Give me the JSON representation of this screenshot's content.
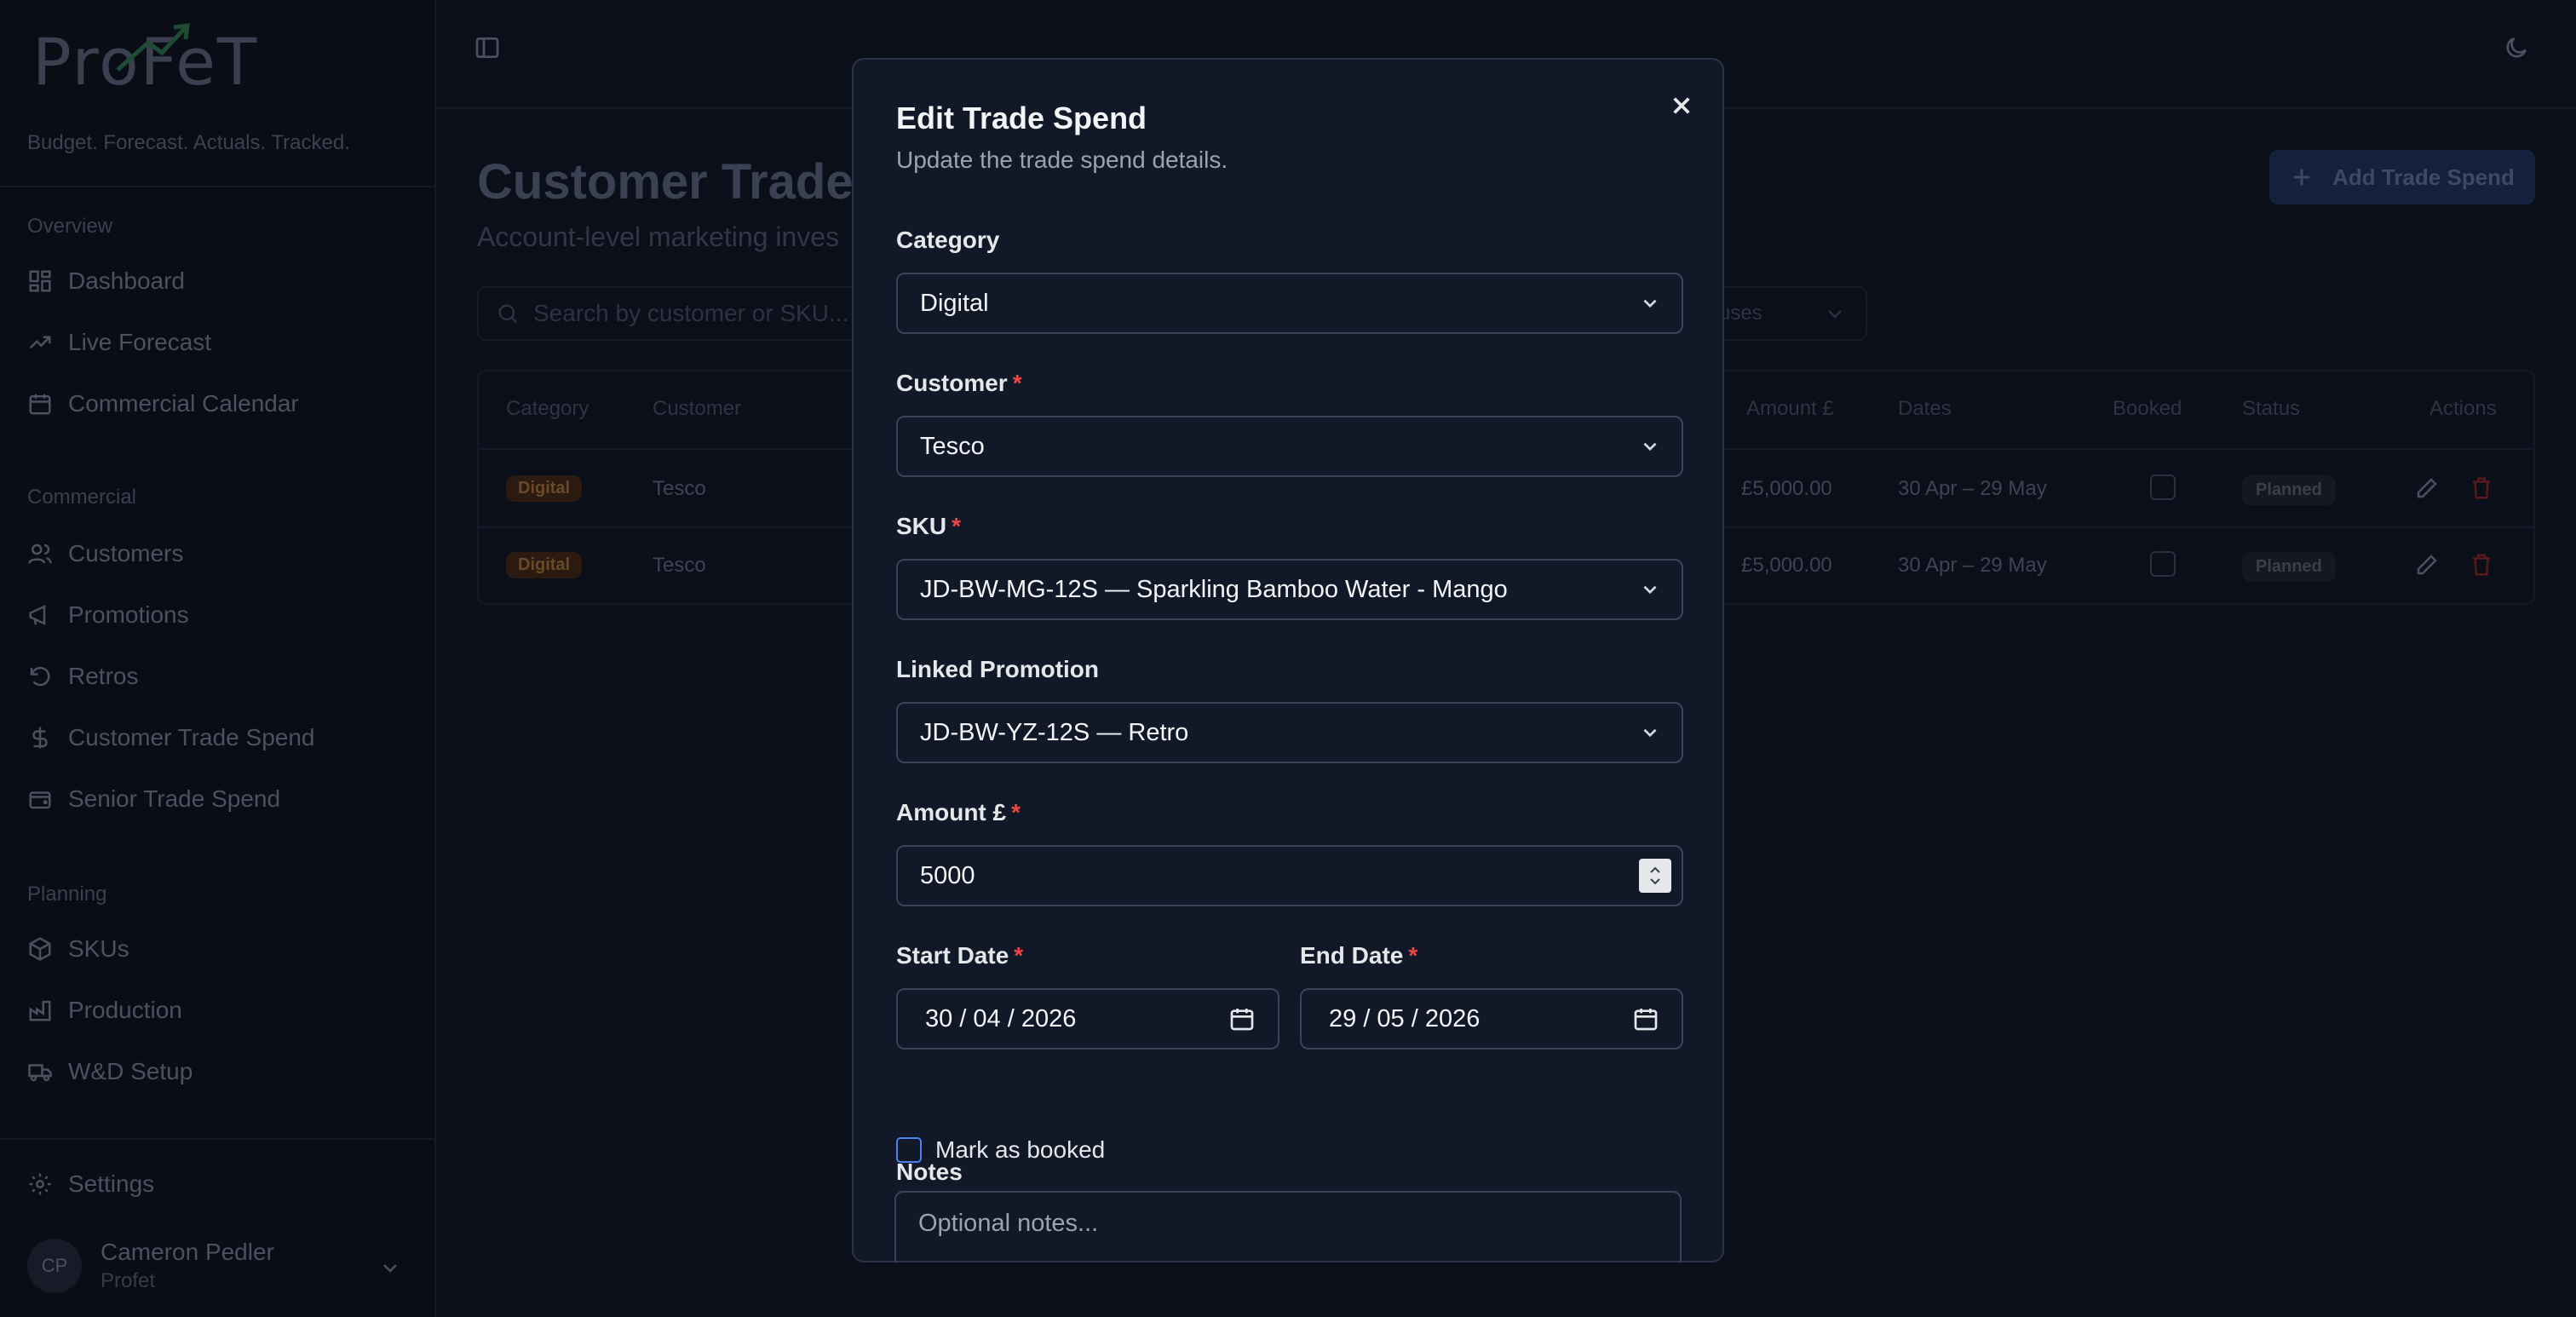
{
  "app": {
    "logo_text": "ProFeT",
    "tagline": "Budget. Forecast. Actuals. Tracked."
  },
  "sidebar": {
    "sections": [
      {
        "title": "Overview",
        "items": [
          {
            "label": "Dashboard",
            "icon": "grid-icon"
          },
          {
            "label": "Live Forecast",
            "icon": "trending-up-icon"
          },
          {
            "label": "Commercial Calendar",
            "icon": "calendar-icon"
          }
        ]
      },
      {
        "title": "Commercial",
        "items": [
          {
            "label": "Customers",
            "icon": "users-icon"
          },
          {
            "label": "Promotions",
            "icon": "megaphone-icon"
          },
          {
            "label": "Retros",
            "icon": "rotate-ccw-icon"
          },
          {
            "label": "Customer Trade Spend",
            "icon": "dollar-icon"
          },
          {
            "label": "Senior Trade Spend",
            "icon": "wallet-icon"
          }
        ]
      },
      {
        "title": "Planning",
        "items": [
          {
            "label": "SKUs",
            "icon": "box-icon"
          },
          {
            "label": "Production",
            "icon": "factory-icon"
          },
          {
            "label": "W&D Setup",
            "icon": "truck-icon"
          }
        ]
      }
    ],
    "settings_label": "Settings",
    "user": {
      "initials": "CP",
      "name": "Cameron Pedler",
      "org": "Profet"
    }
  },
  "page": {
    "title": "Customer Trade",
    "subtitle": "Account-level marketing inves",
    "add_button": "Add Trade Spend",
    "search_placeholder": "Search by customer or SKU...",
    "status_filter": "uses"
  },
  "table": {
    "headers": [
      "Category",
      "Customer",
      "Amount £",
      "Dates",
      "Booked",
      "Status",
      "Actions"
    ],
    "rows": [
      {
        "category": "Digital",
        "customer": "Tesco",
        "amount": "£5,000.00",
        "dates": "30 Apr – 29 May",
        "status": "Planned"
      },
      {
        "category": "Digital",
        "customer": "Tesco",
        "amount": "£5,000.00",
        "dates": "30 Apr – 29 May",
        "status": "Planned"
      }
    ]
  },
  "modal": {
    "title": "Edit Trade Spend",
    "subtitle": "Update the trade spend details.",
    "category": {
      "label": "Category",
      "value": "Digital"
    },
    "customer": {
      "label": "Customer",
      "value": "Tesco"
    },
    "sku": {
      "label": "SKU",
      "value": "JD-BW-MG-12S — Sparkling Bamboo Water - Mango"
    },
    "promotion": {
      "label": "Linked Promotion",
      "value": "JD-BW-YZ-12S — Retro"
    },
    "amount": {
      "label": "Amount £",
      "value": "5000"
    },
    "start_date": {
      "label": "Start Date",
      "value": "30 / 04 / 2026"
    },
    "end_date": {
      "label": "End Date",
      "value": "29 / 05 / 2026"
    },
    "booked": {
      "label": "Mark as booked"
    },
    "notes": {
      "label": "Notes",
      "placeholder": "Optional notes..."
    },
    "required_mark": "*"
  }
}
